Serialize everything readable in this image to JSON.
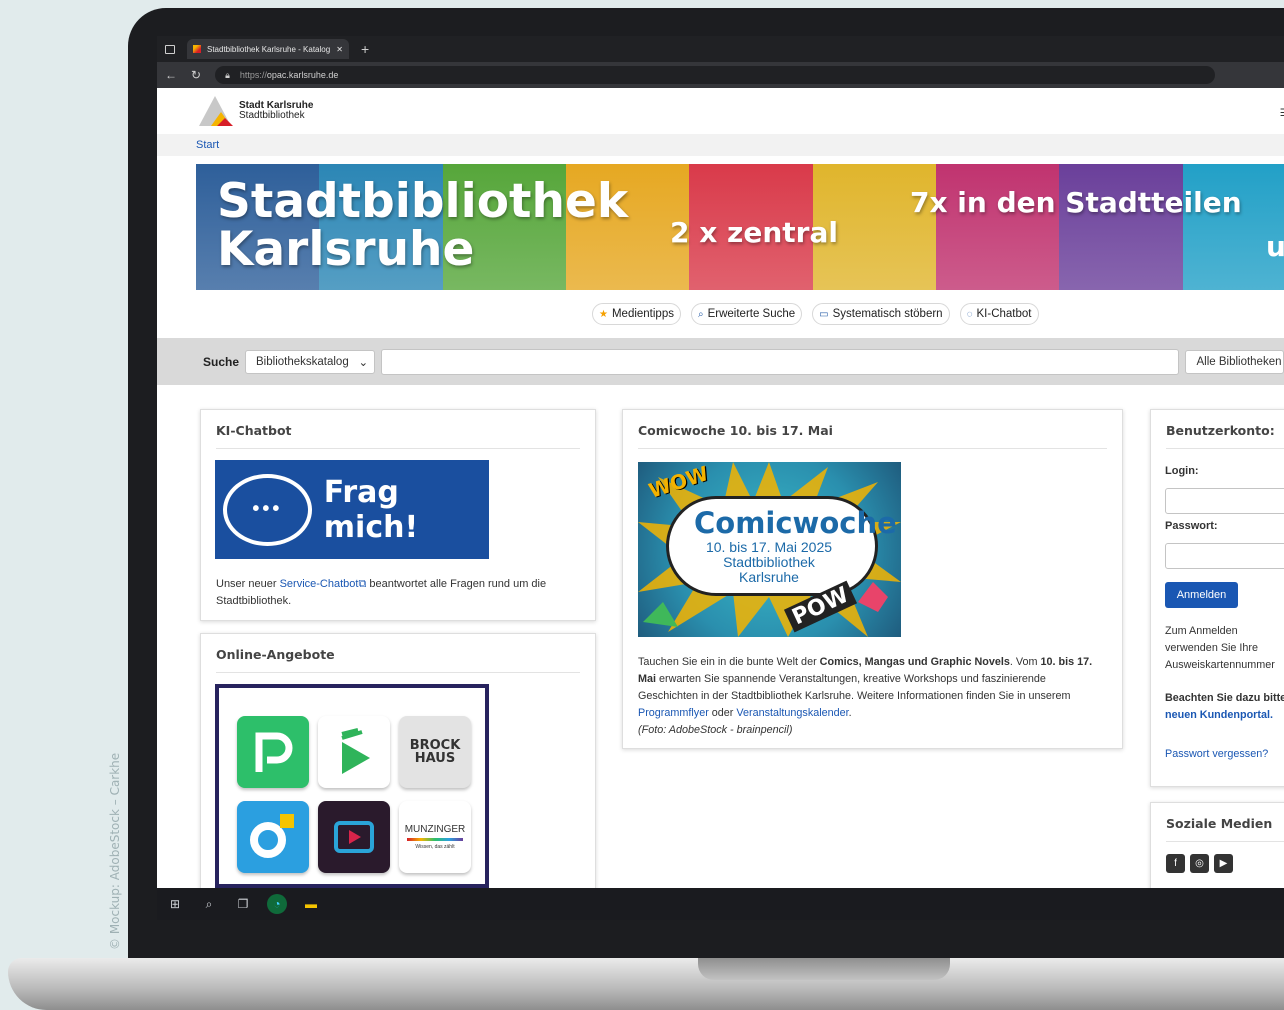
{
  "credit": "© Mockup: AdobeStock – Carkhe",
  "browser": {
    "tab_title": "Stadtbibliothek Karlsruhe - Katalog",
    "url_prefix": "https://",
    "url_domain": "opac.karlsruhe.de"
  },
  "site": {
    "logo_line1": "Stadt Karlsruhe",
    "logo_line2": "Stadtbibliothek",
    "breadcrumb": "Start"
  },
  "banner": {
    "line1": "Stadtbibliothek",
    "line2": "Karlsruhe",
    "zentral": "2 x zentral",
    "stadtteile": "7x in den Stadtteilen",
    "cut_letter": "u",
    "colors": [
      "#2e5f9a",
      "#2b86b5",
      "#56a63a",
      "#e6a822",
      "#d93a4a",
      "#e0b52c",
      "#c0336f",
      "#6a3f9a",
      "#22a0c7"
    ]
  },
  "quicklinks": [
    {
      "icon": "star-icon",
      "label": "Medientipps"
    },
    {
      "icon": "search-icon",
      "label": "Erweiterte Suche"
    },
    {
      "icon": "folder-icon",
      "label": "Systematisch stöbern"
    },
    {
      "icon": "chat-icon",
      "label": "KI-Chatbot"
    }
  ],
  "search": {
    "label": "Suche",
    "scope": "Bibliothekskatalog",
    "library": "Alle Bibliotheken"
  },
  "chatbot_card": {
    "title": "KI-Chatbot",
    "graphic_text": "Frag mich!",
    "text_before": "Unser neuer ",
    "link": "Service-Chatbot",
    "text_after": " beantwortet alle Fragen rund um die Stadtbibliothek."
  },
  "online_card": {
    "title": "Online-Angebote",
    "brockhaus_line1": "BROCK",
    "brockhaus_line2": "HAUS",
    "munzinger": "MUNZINGER",
    "munzinger_sub": "Wissen, das zählt"
  },
  "comic_card": {
    "title": "Comicwoche 10. bis 17. Mai",
    "img_title": "Comicwoche",
    "img_sub1": "10. bis 17. Mai 2025",
    "img_sub2": "Stadtbibliothek Karlsruhe",
    "wow": "WOW",
    "pow": "POW",
    "p1": "Tauchen Sie ein in die bunte Welt der ",
    "p1_bold": "Comics, Mangas und Graphic Novels",
    "p2": ". Vom ",
    "p2_bold": "10. bis 17. Mai",
    "p3": " erwarten Sie spannende Veranstaltungen, kreative Workshops und faszinierende Geschichten in der Stadtbibliothek Karlsruhe. Weitere Informationen finden Sie in unserem ",
    "link1": "Programmflyer",
    "p4": " oder ",
    "link2": "Veranstaltungskalender",
    "p5": ".",
    "caption": "(Foto: AdobeStock - brainpencil)"
  },
  "account_card": {
    "title": "Benutzerkonto:",
    "login_label": "Login:",
    "password_label": "Passwort:",
    "submit": "Anmelden",
    "hint": "Zum Anmelden verwenden Sie Ihre Ausweiskartennummer als Login und Passwort.",
    "note_bold": "Beachten Sie dazu bitte",
    "note_link": "neuen Kundenportal.",
    "forgot": "Passwort vergessen?"
  },
  "social_card": {
    "title": "Soziale Medien",
    "icons": [
      "facebook-icon",
      "instagram-icon",
      "youtube-icon"
    ]
  }
}
